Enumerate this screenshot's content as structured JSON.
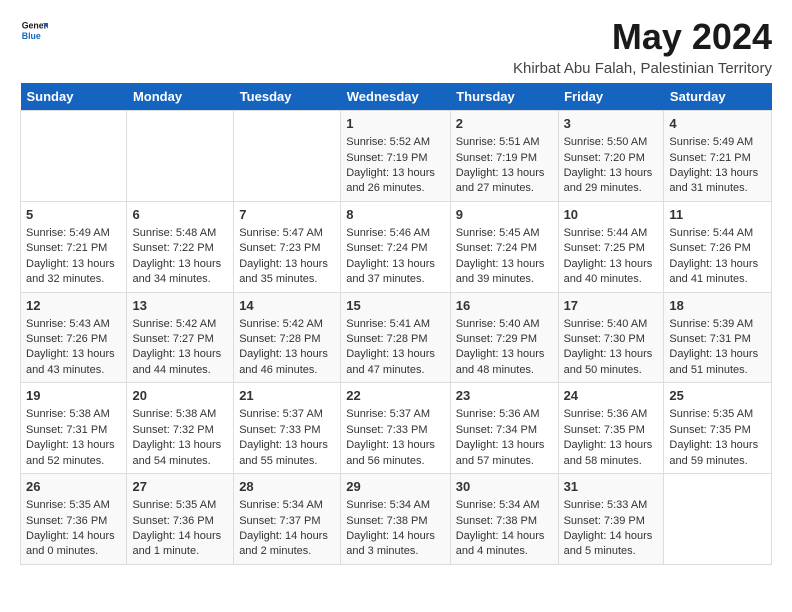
{
  "logo": {
    "general": "General",
    "blue": "Blue"
  },
  "title": "May 2024",
  "subtitle": "Khirbat Abu Falah, Palestinian Territory",
  "days_of_week": [
    "Sunday",
    "Monday",
    "Tuesday",
    "Wednesday",
    "Thursday",
    "Friday",
    "Saturday"
  ],
  "weeks": [
    [
      {
        "day": "",
        "content": ""
      },
      {
        "day": "",
        "content": ""
      },
      {
        "day": "",
        "content": ""
      },
      {
        "day": "1",
        "content": "Sunrise: 5:52 AM\nSunset: 7:19 PM\nDaylight: 13 hours and 26 minutes."
      },
      {
        "day": "2",
        "content": "Sunrise: 5:51 AM\nSunset: 7:19 PM\nDaylight: 13 hours and 27 minutes."
      },
      {
        "day": "3",
        "content": "Sunrise: 5:50 AM\nSunset: 7:20 PM\nDaylight: 13 hours and 29 minutes."
      },
      {
        "day": "4",
        "content": "Sunrise: 5:49 AM\nSunset: 7:21 PM\nDaylight: 13 hours and 31 minutes."
      }
    ],
    [
      {
        "day": "5",
        "content": "Sunrise: 5:49 AM\nSunset: 7:21 PM\nDaylight: 13 hours and 32 minutes."
      },
      {
        "day": "6",
        "content": "Sunrise: 5:48 AM\nSunset: 7:22 PM\nDaylight: 13 hours and 34 minutes."
      },
      {
        "day": "7",
        "content": "Sunrise: 5:47 AM\nSunset: 7:23 PM\nDaylight: 13 hours and 35 minutes."
      },
      {
        "day": "8",
        "content": "Sunrise: 5:46 AM\nSunset: 7:24 PM\nDaylight: 13 hours and 37 minutes."
      },
      {
        "day": "9",
        "content": "Sunrise: 5:45 AM\nSunset: 7:24 PM\nDaylight: 13 hours and 39 minutes."
      },
      {
        "day": "10",
        "content": "Sunrise: 5:44 AM\nSunset: 7:25 PM\nDaylight: 13 hours and 40 minutes."
      },
      {
        "day": "11",
        "content": "Sunrise: 5:44 AM\nSunset: 7:26 PM\nDaylight: 13 hours and 41 minutes."
      }
    ],
    [
      {
        "day": "12",
        "content": "Sunrise: 5:43 AM\nSunset: 7:26 PM\nDaylight: 13 hours and 43 minutes."
      },
      {
        "day": "13",
        "content": "Sunrise: 5:42 AM\nSunset: 7:27 PM\nDaylight: 13 hours and 44 minutes."
      },
      {
        "day": "14",
        "content": "Sunrise: 5:42 AM\nSunset: 7:28 PM\nDaylight: 13 hours and 46 minutes."
      },
      {
        "day": "15",
        "content": "Sunrise: 5:41 AM\nSunset: 7:28 PM\nDaylight: 13 hours and 47 minutes."
      },
      {
        "day": "16",
        "content": "Sunrise: 5:40 AM\nSunset: 7:29 PM\nDaylight: 13 hours and 48 minutes."
      },
      {
        "day": "17",
        "content": "Sunrise: 5:40 AM\nSunset: 7:30 PM\nDaylight: 13 hours and 50 minutes."
      },
      {
        "day": "18",
        "content": "Sunrise: 5:39 AM\nSunset: 7:31 PM\nDaylight: 13 hours and 51 minutes."
      }
    ],
    [
      {
        "day": "19",
        "content": "Sunrise: 5:38 AM\nSunset: 7:31 PM\nDaylight: 13 hours and 52 minutes."
      },
      {
        "day": "20",
        "content": "Sunrise: 5:38 AM\nSunset: 7:32 PM\nDaylight: 13 hours and 54 minutes."
      },
      {
        "day": "21",
        "content": "Sunrise: 5:37 AM\nSunset: 7:33 PM\nDaylight: 13 hours and 55 minutes."
      },
      {
        "day": "22",
        "content": "Sunrise: 5:37 AM\nSunset: 7:33 PM\nDaylight: 13 hours and 56 minutes."
      },
      {
        "day": "23",
        "content": "Sunrise: 5:36 AM\nSunset: 7:34 PM\nDaylight: 13 hours and 57 minutes."
      },
      {
        "day": "24",
        "content": "Sunrise: 5:36 AM\nSunset: 7:35 PM\nDaylight: 13 hours and 58 minutes."
      },
      {
        "day": "25",
        "content": "Sunrise: 5:35 AM\nSunset: 7:35 PM\nDaylight: 13 hours and 59 minutes."
      }
    ],
    [
      {
        "day": "26",
        "content": "Sunrise: 5:35 AM\nSunset: 7:36 PM\nDaylight: 14 hours and 0 minutes."
      },
      {
        "day": "27",
        "content": "Sunrise: 5:35 AM\nSunset: 7:36 PM\nDaylight: 14 hours and 1 minute."
      },
      {
        "day": "28",
        "content": "Sunrise: 5:34 AM\nSunset: 7:37 PM\nDaylight: 14 hours and 2 minutes."
      },
      {
        "day": "29",
        "content": "Sunrise: 5:34 AM\nSunset: 7:38 PM\nDaylight: 14 hours and 3 minutes."
      },
      {
        "day": "30",
        "content": "Sunrise: 5:34 AM\nSunset: 7:38 PM\nDaylight: 14 hours and 4 minutes."
      },
      {
        "day": "31",
        "content": "Sunrise: 5:33 AM\nSunset: 7:39 PM\nDaylight: 14 hours and 5 minutes."
      },
      {
        "day": "",
        "content": ""
      }
    ]
  ]
}
